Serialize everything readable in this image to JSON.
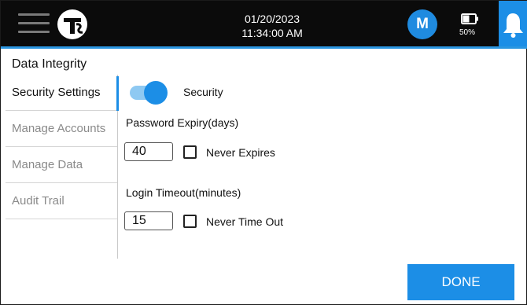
{
  "header": {
    "date": "01/20/2023",
    "time": "11:34:00 AM",
    "user_initial": "M",
    "battery_percent": "50%",
    "battery_level": 0.5,
    "icons": {
      "menu": "hamburger-menu-icon",
      "logo": "tsi-logo-icon",
      "battery": "battery-icon",
      "bell": "bell-icon"
    }
  },
  "page": {
    "title": "Data Integrity"
  },
  "sidebar": {
    "items": [
      {
        "label": "Security Settings",
        "active": true
      },
      {
        "label": "Manage Accounts",
        "active": false
      },
      {
        "label": "Manage Data",
        "active": false
      },
      {
        "label": "Audit Trail",
        "active": false
      }
    ]
  },
  "security": {
    "toggle_label": "Security",
    "toggle_on": true,
    "password_expiry_label": "Password Expiry(days)",
    "password_expiry_value": "40",
    "never_expires_label": "Never Expires",
    "never_expires_checked": false,
    "login_timeout_label": "Login Timeout(minutes)",
    "login_timeout_value": "15",
    "never_time_out_label": "Never Time Out",
    "never_time_out_checked": false
  },
  "footer": {
    "done_label": "DONE"
  },
  "colors": {
    "accent": "#1c8ee6",
    "toggle_track": "#8ec9f2",
    "topbar": "#0b0b0b"
  }
}
